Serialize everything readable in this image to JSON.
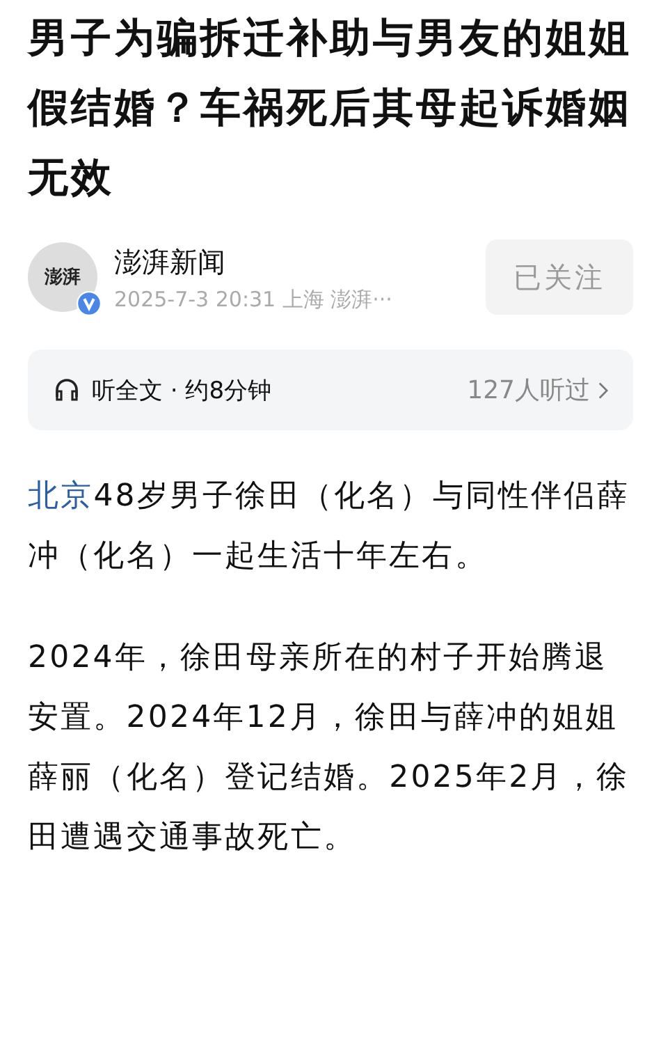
{
  "title": "男子为骗拆迁补助与男友的姐姐假结婚？车祸死后其母起诉婚姻无效",
  "author": {
    "avatar_text": "澎湃",
    "name": "澎湃新闻",
    "verified": true,
    "meta": "2025-7-3 20:31 上海  澎湃···",
    "follow_label": "已关注",
    "following": true
  },
  "listen": {
    "label": "听全文 · 约8分钟",
    "count": "127人听过"
  },
  "paragraphs": [
    {
      "location": "北京",
      "text": "48岁男子徐田（化名）与同性伴侣薛冲（化名）一起生活十年左右。"
    },
    {
      "text": "2024年，徐田母亲所在的村子开始腾退安置。2024年12月，徐田与薛冲的姐姐薛丽（化名）登记结婚。2025年2月，徐田遭遇交通事故死亡。"
    }
  ]
}
